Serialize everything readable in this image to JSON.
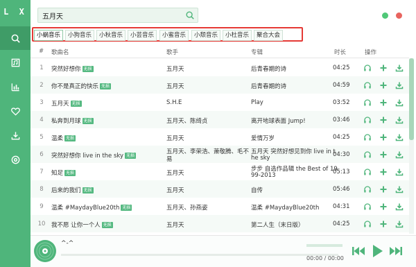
{
  "app": {
    "logo": "L X",
    "accent_color": "#4fb57b"
  },
  "sidebar": {
    "items": [
      {
        "name": "search",
        "icon": "search-icon",
        "active": true
      },
      {
        "name": "songlist",
        "icon": "playlist-icon",
        "active": false
      },
      {
        "name": "leaderboard",
        "icon": "chart-icon",
        "active": false
      },
      {
        "name": "favorites",
        "icon": "heart-icon",
        "active": false
      },
      {
        "name": "downloads",
        "icon": "download-icon",
        "active": false
      },
      {
        "name": "settings",
        "icon": "gear-icon",
        "active": false
      }
    ]
  },
  "search": {
    "value": "五月天",
    "icon": "search-icon"
  },
  "window": {
    "minimize_color": "#50c878",
    "close_color": "#e8645f"
  },
  "sources": {
    "tabs": [
      "小蜗音乐",
      "小狗音乐",
      "小秋音乐",
      "小芸音乐",
      "小蜜音乐",
      "小颓音乐",
      "小杜音乐",
      "聚合大会"
    ],
    "active_index": 0
  },
  "table": {
    "headers": {
      "num": "#",
      "name": "歌曲名",
      "singer": "歌手",
      "album": "专辑",
      "duration": "时长",
      "actions": "操作"
    },
    "badge": "无损",
    "rows": [
      {
        "num": "1",
        "name": "突然好想你",
        "badge": true,
        "singer": "五月天",
        "album": "后青春期的诗",
        "duration": "04:25"
      },
      {
        "num": "2",
        "name": "你不是真正的快乐",
        "badge": true,
        "singer": "五月天",
        "album": "后青春期的诗",
        "duration": "04:59"
      },
      {
        "num": "3",
        "name": "五月天",
        "badge": true,
        "singer": "S.H.E",
        "album": "Play",
        "duration": "03:52"
      },
      {
        "num": "4",
        "name": "私奔到月球",
        "badge": true,
        "singer": "五月天、陈绮贞",
        "album": "离开地球表面 Jump!",
        "duration": "03:46"
      },
      {
        "num": "5",
        "name": "温柔",
        "badge": true,
        "singer": "五月天",
        "album": "爱情万岁",
        "duration": "04:25"
      },
      {
        "num": "6",
        "name": "突然好想你 live in the sky",
        "badge": true,
        "singer": [
          "五月天、李荣浩、萧敬腾、毛不",
          "易"
        ],
        "album": [
          "五月天 突然好想见到你 live in t",
          "he sky"
        ],
        "duration": "04:30"
      },
      {
        "num": "7",
        "name": "知足",
        "badge": true,
        "singer": "五月天",
        "album": [
          "步步 自选作品辑 the Best of 19",
          "99-2013"
        ],
        "duration": "05:13"
      },
      {
        "num": "8",
        "name": "后来的我们",
        "badge": true,
        "singer": "五月天",
        "album": "自传",
        "duration": "05:46"
      },
      {
        "num": "9",
        "name": "温柔 #MaydayBlue20th",
        "badge": true,
        "singer": "五月天、孙燕姿",
        "album": "温柔 #MaydayBlue20th",
        "duration": "04:31"
      },
      {
        "num": "10",
        "name": "我不愿 让你一个人",
        "badge": true,
        "singer": "五月天",
        "album": "第二人生（末日版）",
        "duration": "04:25"
      }
    ]
  },
  "player": {
    "track": "^-^",
    "current_time": "00:00",
    "total_time": "00:00",
    "time_text": "00:00 / 00:00",
    "progress": 0.0
  }
}
